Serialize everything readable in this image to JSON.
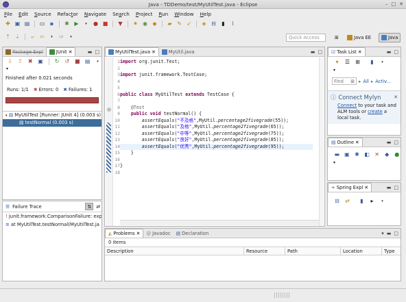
{
  "window": {
    "title": "Java - TDDemo/test/MyUtilTest.java - Eclipse"
  },
  "menu": [
    {
      "u": "F",
      "rest": "ile"
    },
    {
      "u": "E",
      "rest": "dit"
    },
    {
      "u": "S",
      "rest": "ource"
    },
    {
      "u": "",
      "rest": "Refac",
      "u2": "t",
      "rest2": "or"
    },
    {
      "u": "N",
      "rest": "avigate"
    },
    {
      "u": "",
      "rest": "Se",
      "u2": "a",
      "rest2": "rch"
    },
    {
      "u": "P",
      "rest": "roject"
    },
    {
      "u": "R",
      "rest": "un"
    },
    {
      "u": "W",
      "rest": "indow"
    },
    {
      "u": "H",
      "rest": "elp"
    }
  ],
  "quick_access": {
    "placeholder": "Quick Access"
  },
  "perspectives": [
    "Java EE",
    "Java"
  ],
  "left_panel": {
    "tabs": [
      "Package Expl",
      "JUnit"
    ],
    "finished": "Finished after 0.021 seconds",
    "runs_label": "Runs:",
    "runs_value": "1/1",
    "errors_label": "Errors:",
    "errors_value": "0",
    "failures_label": "Failures:",
    "failures_value": "1",
    "tree_root": "MyUtilTest [Runner: JUnit 4] (0.003 s)",
    "tree_child": "testNormal (0.003 s)",
    "failure_trace_title": "Failure Trace",
    "trace_lines": [
      "junit.framework.ComparisonFailure: exp",
      "at MyUtilTest.testNormal(MyUtilTest.ja"
    ]
  },
  "editor": {
    "tabs": [
      "MyUtilTest.java",
      "MyUtil.java"
    ],
    "line_numbers": [
      "1",
      "2",
      "3",
      "4",
      "5",
      "6",
      "7",
      "8",
      "9",
      "10",
      "11",
      "12",
      "13",
      "14",
      "15",
      "16",
      "17",
      "18"
    ]
  },
  "right_top": {
    "tab": "Task List",
    "find_placeholder": "Find",
    "all_label": "All",
    "activate_label": "Activ...",
    "mylyn_title": "Connect Mylyn",
    "mylyn_connect": "Connect",
    "mylyn_text1": " to your task and",
    "mylyn_text2": "ALM tools or ",
    "mylyn_create": "create",
    "mylyn_text3": " a",
    "mylyn_text4": "local task."
  },
  "outline": {
    "tab": "Outline"
  },
  "spring": {
    "tab": "Spring Expl"
  },
  "bottom": {
    "tabs": [
      "Problems",
      "Javadoc",
      "Declaration"
    ],
    "items": "0 items",
    "columns": [
      "Description",
      "Resource",
      "Path",
      "Location",
      "Type"
    ]
  },
  "colors": {
    "failure_bar": "#a94442",
    "keyword": "#7f0055",
    "string": "#2a00ff"
  }
}
